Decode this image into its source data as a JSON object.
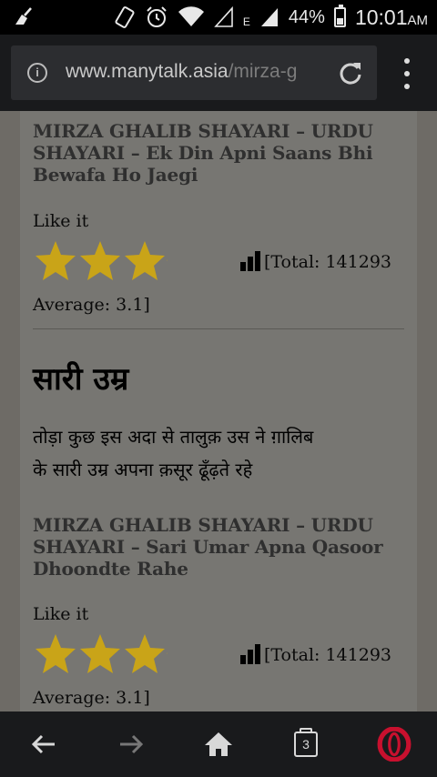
{
  "status_bar": {
    "battery": "44%",
    "time": "10:01",
    "ampm": "AM",
    "network": "E"
  },
  "browser": {
    "url_domain": "www.manytalk.asia",
    "url_path": "/mirza-g",
    "open_tabs": "3"
  },
  "posts": [
    {
      "subtitle": "MIRZA GHALIB SHAYARI – URDU SHAYARI – Ek Din Apni Saans Bhi Bewafa Ho Jaegi",
      "like_label": "Like it",
      "stars": 3,
      "total": "[Total: 141293",
      "average": "Average: 3.1]"
    },
    {
      "title": "सारी उम्र",
      "poem_line_1": "तोड़ा कुछ इस अदा से तालुक़ उस ने ग़ालिब",
      "poem_line_2": "के सारी उम्र अपना क़सूर ढूँढ़ते रहे",
      "subtitle": "MIRZA GHALIB SHAYARI – URDU SHAYARI – Sari Umar Apna Qasoor Dhoondte Rahe",
      "like_label": "Like it",
      "stars": 3,
      "total": "[Total: 141293",
      "average": "Average: 3.1]"
    }
  ],
  "colors": {
    "star": "#c9a418",
    "opera_red": "#c8102e"
  }
}
